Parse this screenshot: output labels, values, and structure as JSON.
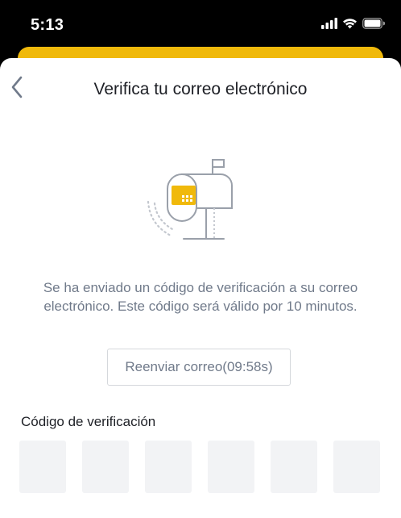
{
  "status_bar": {
    "time": "5:13",
    "icons": [
      "cellular-signal-icon",
      "wifi-icon",
      "battery-icon"
    ]
  },
  "colors": {
    "accent": "#F0B90B",
    "text_primary": "#1E2026",
    "text_secondary": "#707A8A",
    "input_bg": "#F2F3F5"
  },
  "nav": {
    "back_icon": "chevron-left-icon",
    "title": "Verifica tu correo electrónico"
  },
  "illustration": {
    "icon": "mailbox-icon"
  },
  "message": "Se ha enviado un código de verificación a su correo electrónico. Este código será válido por 10 minutos.",
  "resend_button": {
    "label": "Reenviar correo(09:58s)"
  },
  "code_input": {
    "label": "Código de verificación",
    "digits": [
      "",
      "",
      "",
      "",
      "",
      ""
    ]
  }
}
